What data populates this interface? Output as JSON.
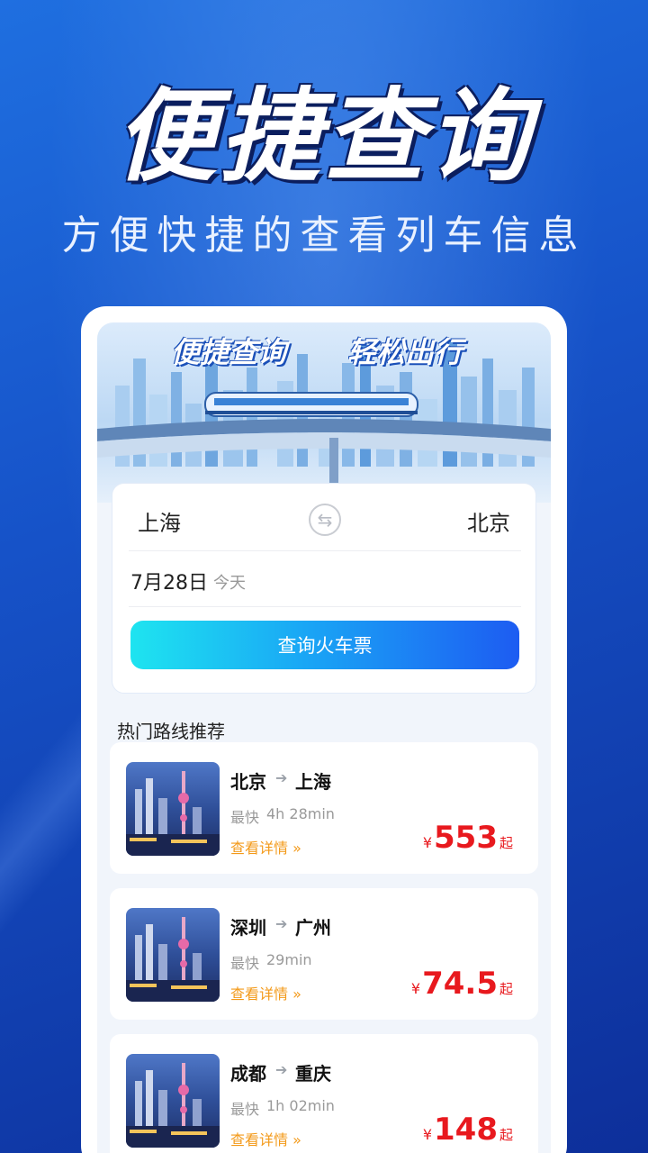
{
  "hero": {
    "title": "便捷查询",
    "subtitle": "方便快捷的查看列车信息"
  },
  "banner": {
    "slogan_left": "便捷查询",
    "slogan_right": "轻松出行"
  },
  "search": {
    "from_city": "上海",
    "to_city": "北京",
    "swap_icon": "⇆",
    "date": "7月28日",
    "date_note": "今天",
    "button_label": "查询火车票"
  },
  "routes": {
    "section_title": "热门路线推荐",
    "arrow": "➔",
    "fastest_label": "最快",
    "detail_link": "查看详情 »",
    "currency": "¥",
    "price_suffix": "起",
    "items": [
      {
        "from": "北京",
        "to": "上海",
        "duration": "4h 28min",
        "price": "553"
      },
      {
        "from": "深圳",
        "to": "广州",
        "duration": "29min",
        "price": "74.5"
      },
      {
        "from": "成都",
        "to": "重庆",
        "duration": "1h 02min",
        "price": "148"
      }
    ]
  },
  "colors": {
    "accent_blue": "#1d5cf2",
    "accent_cyan": "#1ee4f0",
    "price_red": "#e8191e",
    "link_orange": "#f39a1a"
  }
}
